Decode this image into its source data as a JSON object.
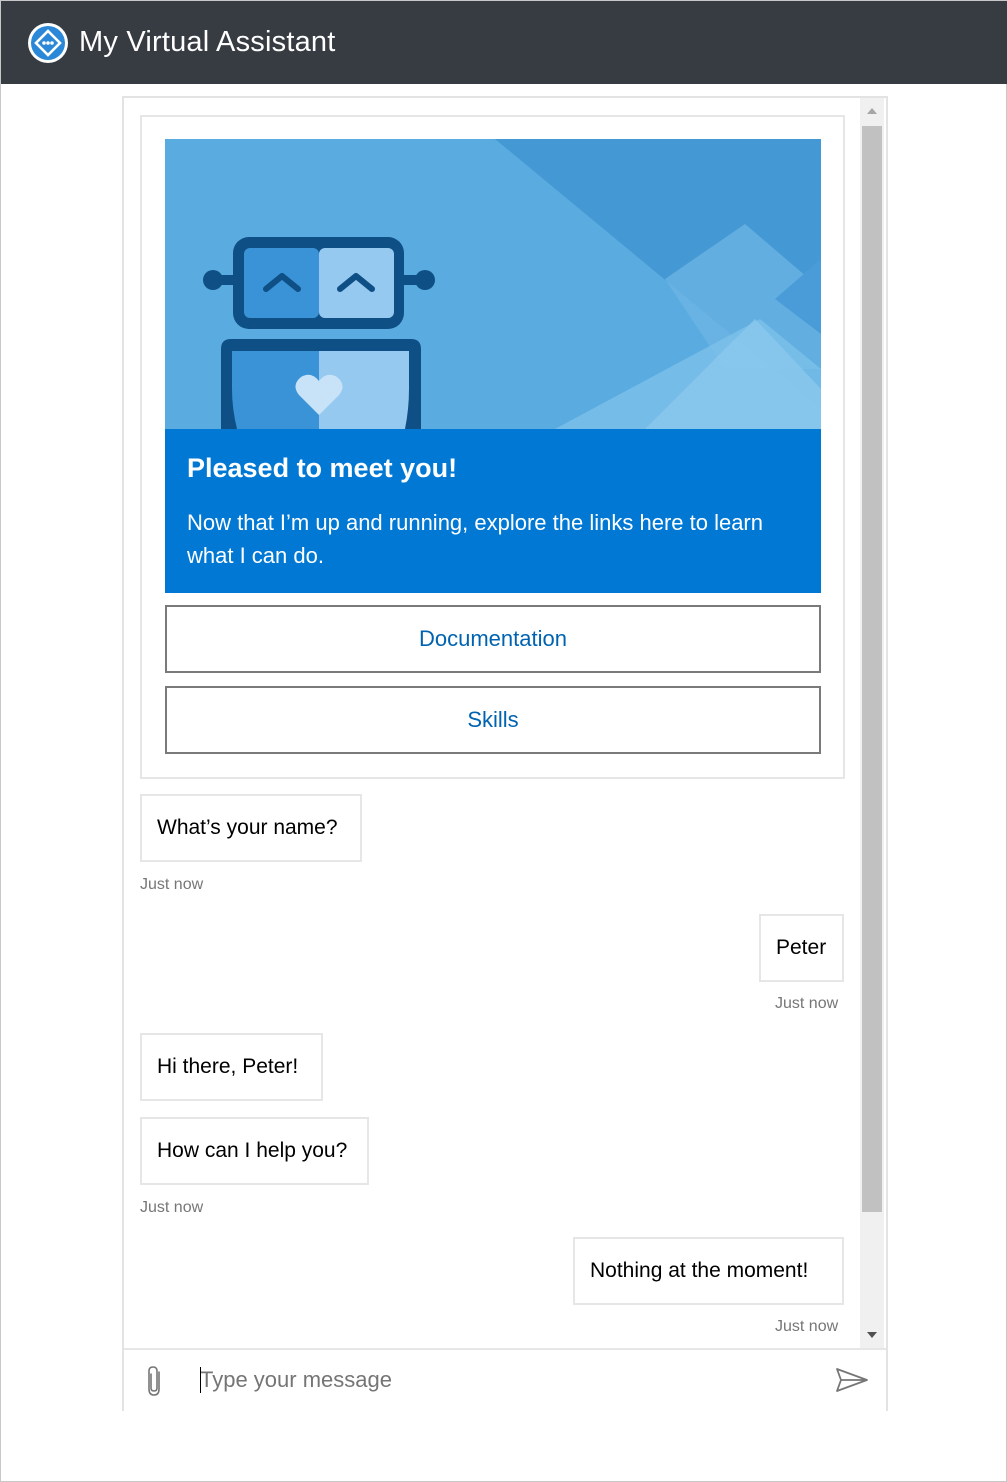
{
  "app": {
    "title": "My Virtual Assistant"
  },
  "card": {
    "title": "Pleased to meet you!",
    "text": "Now that I’m up and running, explore the links here to learn what I can do.",
    "actions": [
      {
        "label": "Documentation"
      },
      {
        "label": "Skills"
      }
    ]
  },
  "messages": [
    {
      "from": "bot",
      "text": "What’s your name?",
      "timestamp": "Just now"
    },
    {
      "from": "user",
      "text": "Peter",
      "timestamp": "Just now"
    },
    {
      "from": "bot",
      "text": "Hi there, Peter!"
    },
    {
      "from": "bot",
      "text": "How can I help you?",
      "timestamp": "Just now"
    },
    {
      "from": "user",
      "text": "Nothing at the moment!",
      "timestamp": "Just now"
    }
  ],
  "sendbox": {
    "placeholder": "Type your message"
  },
  "colors": {
    "titlebar": "#373b42",
    "accent": "#0078d4",
    "link": "#0063b1",
    "hero": "#5aace0"
  },
  "icons": [
    "assistant-logo-icon",
    "robot-illustration",
    "paperclip-icon",
    "send-icon"
  ]
}
